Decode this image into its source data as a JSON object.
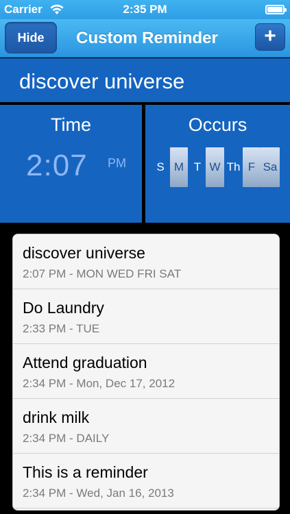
{
  "status_bar": {
    "carrier": "Carrier",
    "time": "2:35 PM",
    "battery_level": 1.0
  },
  "nav": {
    "hide_label": "Hide",
    "title": "Custom Reminder",
    "add_label": "+"
  },
  "reminder_name": "discover universe",
  "time_panel": {
    "label": "Time",
    "hour": "2",
    "separator": ":",
    "minute": "07",
    "ampm": "PM"
  },
  "occurs_panel": {
    "label": "Occurs",
    "days": [
      {
        "label": "S",
        "selected": false
      },
      {
        "label": "M",
        "selected": true
      },
      {
        "label": "T",
        "selected": false
      },
      {
        "label": "W",
        "selected": true
      },
      {
        "label": "Th",
        "selected": false
      },
      {
        "label": "F",
        "selected": true
      },
      {
        "label": "Sa",
        "selected": true
      }
    ]
  },
  "reminders": [
    {
      "title": "discover universe",
      "detail": "2:07 PM - MON WED FRI SAT"
    },
    {
      "title": "Do Laundry",
      "detail": "2:33 PM - TUE"
    },
    {
      "title": "Attend graduation",
      "detail": "2:34 PM - Mon, Dec 17, 2012"
    },
    {
      "title": "drink milk",
      "detail": "2:34 PM - DAILY"
    },
    {
      "title": "This is a reminder",
      "detail": "2:34 PM - Wed, Jan 16, 2013"
    }
  ],
  "colors": {
    "panel_blue": "#1565c0",
    "nav_blue": "#2a95e0",
    "time_text": "#8fb7f5"
  }
}
